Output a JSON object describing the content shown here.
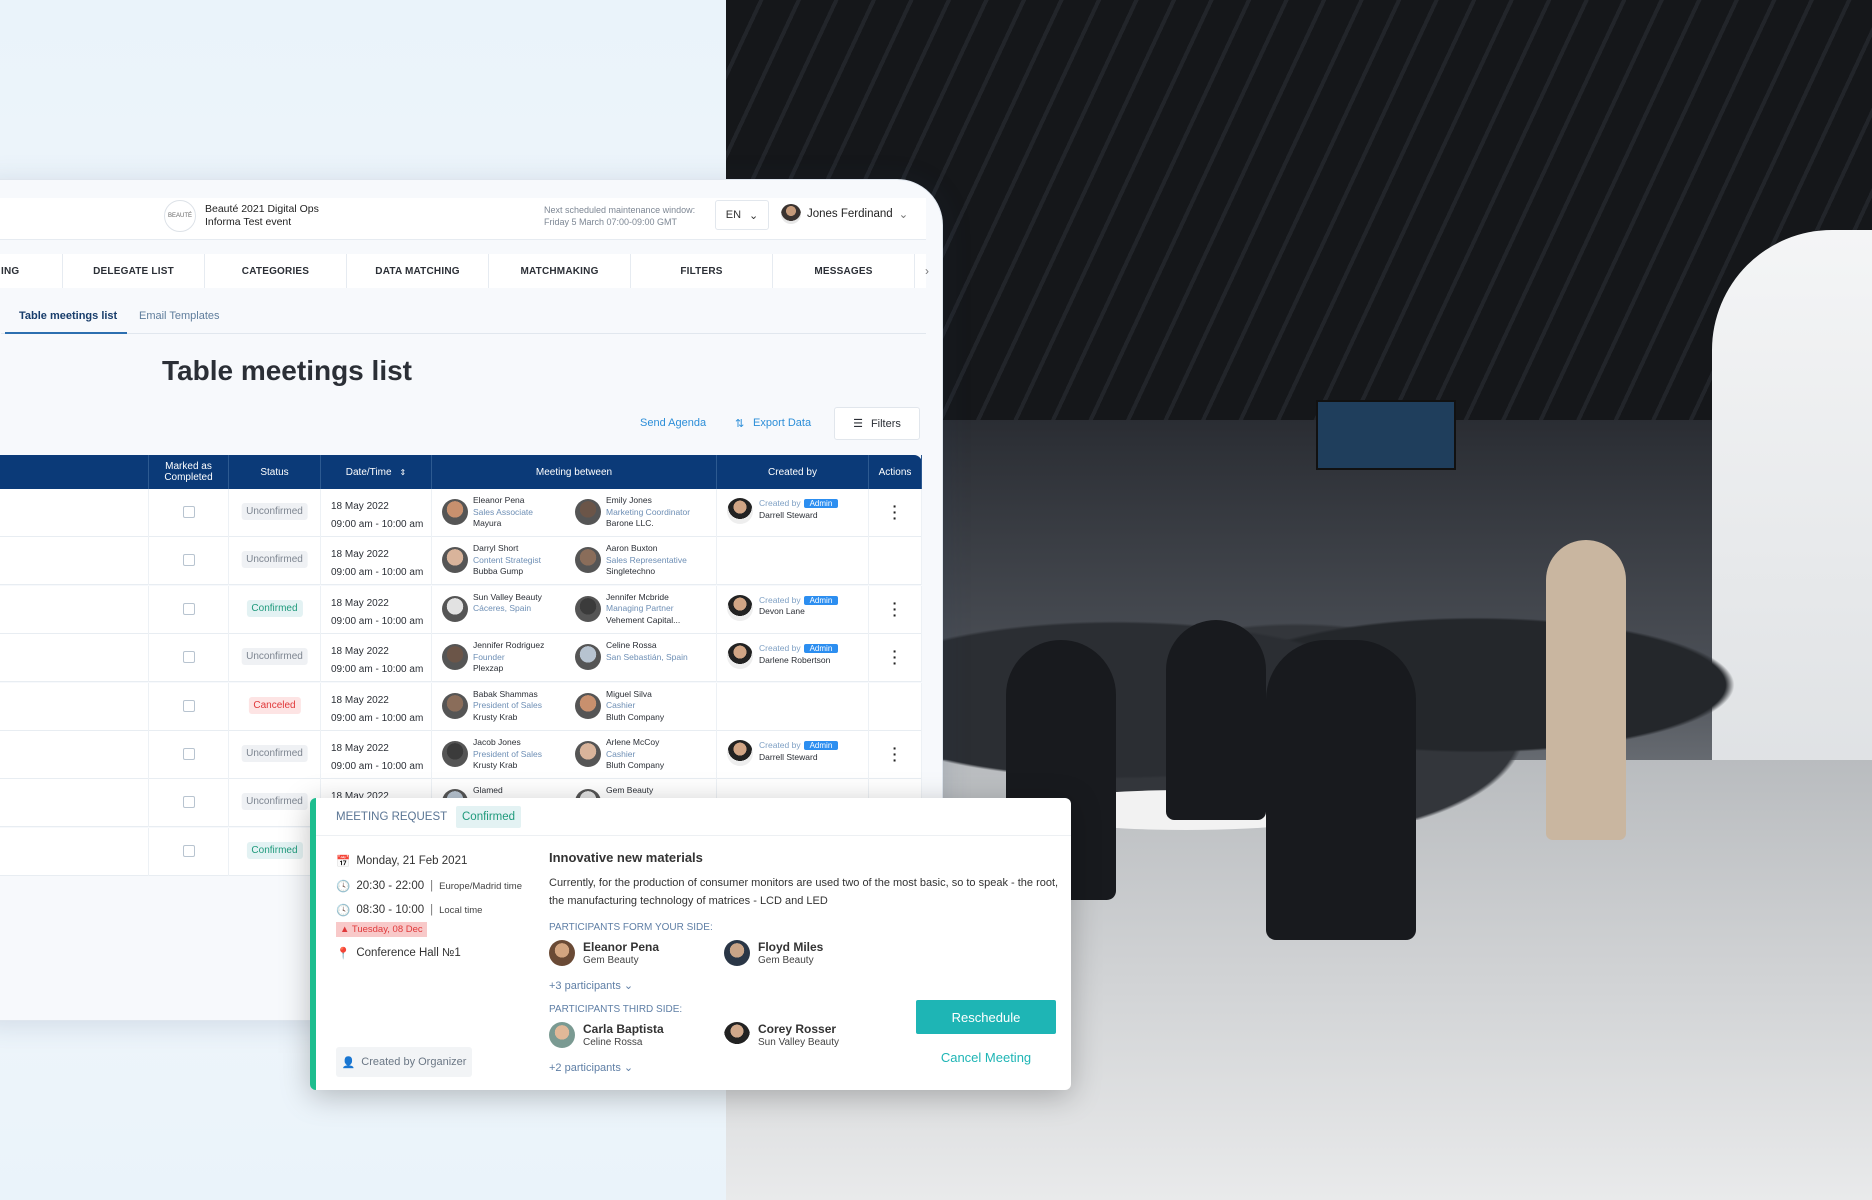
{
  "header": {
    "event_title": "Beauté 2021 Digital Ops",
    "event_subtitle": "Informa Test event",
    "logo_text": "BEAUTÉ",
    "maintenance_label": "Next scheduled maintenance window:",
    "maintenance_time": "Friday 5 March 07:00-09:00 GMT",
    "language": "EN",
    "user_name": "Jones Ferdinand"
  },
  "nav": {
    "tabs": [
      "ING",
      "DELEGATE LIST",
      "CATEGORIES",
      "DATA MATCHING",
      "MATCHMAKING",
      "FILTERS",
      "MESSAGES"
    ]
  },
  "subtabs": {
    "active": "Table meetings list",
    "other": "Email Templates"
  },
  "page": {
    "title": "Table meetings list",
    "send_agenda": "Send Agenda",
    "export_data": "Export Data",
    "filters": "Filters"
  },
  "table": {
    "columns": [
      "",
      "Marked as Completed",
      "Status",
      "Date/Time",
      "Meeting between",
      "Created by",
      "Actions"
    ],
    "rows": [
      {
        "status": "Unconfirmed",
        "date": "18 May 2022",
        "time": "09:00 am - 10:00 am",
        "a": [
          "Eleanor Pena",
          "Sales Associate",
          "Mayura"
        ],
        "b": [
          "Emily Jones",
          "Marketing Coordinator",
          "Barone LLC."
        ],
        "created": [
          "Created by",
          "Admin",
          "Darrell Steward"
        ]
      },
      {
        "status": "Unconfirmed",
        "date": "18 May 2022",
        "time": "09:00 am - 10:00 am",
        "a": [
          "Darryl Short",
          "Content Strategist",
          "Bubba Gump"
        ],
        "b": [
          "Aaron Buxton",
          "Sales Representative",
          "Singletechno"
        ],
        "created": null
      },
      {
        "status": "Confirmed",
        "date": "18 May 2022",
        "time": "09:00 am - 10:00 am",
        "a": [
          "Sun Valley Beauty",
          "Cáceres, Spain",
          ""
        ],
        "b": [
          "Jennifer Mcbride",
          "Managing Partner",
          "Vehement Capital..."
        ],
        "created": [
          "Created by",
          "Admin",
          "Devon Lane"
        ]
      },
      {
        "status": "Unconfirmed",
        "date": "18 May 2022",
        "time": "09:00 am - 10:00 am",
        "a": [
          "Jennifer Rodriguez",
          "Founder",
          "Plexzap"
        ],
        "b": [
          "Celine Rossa",
          "San Sebastián, Spain",
          ""
        ],
        "created": [
          "Created by",
          "Admin",
          "Darlene Robertson"
        ]
      },
      {
        "status": "Canceled",
        "date": "18 May 2022",
        "time": "09:00 am - 10:00 am",
        "a": [
          "Babak Shammas",
          "President of Sales",
          "Krusty Krab"
        ],
        "b": [
          "Miguel Silva",
          "Cashier",
          "Bluth Company"
        ],
        "created": null
      },
      {
        "status": "Unconfirmed",
        "date": "18 May 2022",
        "time": "09:00 am - 10:00 am",
        "a": [
          "Jacob Jones",
          "President of Sales",
          "Krusty Krab"
        ],
        "b": [
          "Arlene McCoy",
          "Cashier",
          "Bluth Company"
        ],
        "created": [
          "Created by",
          "Admin",
          "Darrell Steward"
        ]
      },
      {
        "status": "Unconfirmed",
        "date": "18 May 2022",
        "time": "",
        "a": [
          "Glamed",
          "",
          ""
        ],
        "b": [
          "Gem Beauty",
          "",
          ""
        ],
        "created": null
      },
      {
        "status": "Confirmed",
        "date": "",
        "time": "",
        "a": null,
        "b": null,
        "created": null
      }
    ]
  },
  "popup": {
    "label": "MEETING REQUEST",
    "status": "Confirmed",
    "date": "Monday, 21 Feb 2021",
    "time1": "20:30 - 22:00",
    "tz1": "Europe/Madrid time",
    "time2": "08:30 - 10:00",
    "tz2": "Local time",
    "warning": "Tuesday, 08 Dec",
    "location": "Conference Hall №1",
    "created_by": "Created by Organizer",
    "title": "Innovative new materials",
    "description": "Currently, for the production of consumer monitors are used two of the most basic, so to speak - the root, the manufacturing technology of matrices - LCD and LED",
    "your_side_label": "PARTICIPANTS FORM YOUR SIDE:",
    "your_side": [
      {
        "name": "Eleanor Pena",
        "company": "Gem Beauty"
      },
      {
        "name": "Floyd Miles",
        "company": "Gem Beauty"
      }
    ],
    "your_more": "+3 participants",
    "third_side_label": "PARTICIPANTS THIRD SIDE:",
    "third_side": [
      {
        "name": "Carla Baptista",
        "company": "Celine Rossa"
      },
      {
        "name": "Corey Rosser",
        "company": "Sun Valley Beauty"
      }
    ],
    "third_more": "+2 participants",
    "reschedule": "Reschedule",
    "cancel": "Cancel Meeting"
  },
  "colors": {
    "header_blue": "#0b3a78",
    "accent_teal": "#1eb5b5",
    "link_blue": "#2c8ed8",
    "green_border": "#1dbd8e",
    "canceled": "#e0383a",
    "admin_badge": "#2c8ef0"
  }
}
